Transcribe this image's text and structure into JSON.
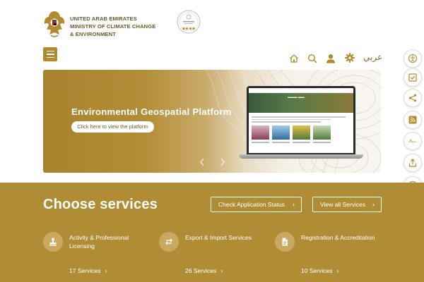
{
  "header": {
    "ministry_lines": [
      "UNITED ARAB EMIRATES",
      "MINISTRY OF CLIMATE CHANGE",
      "& ENVIRONMENT"
    ],
    "icons": [
      "home-icon",
      "search-icon",
      "user-icon",
      "gear-icon"
    ],
    "language_link": "عربي"
  },
  "side_toolbar": {
    "icons": [
      "accessibility-icon",
      "checklist-icon",
      "share-icon",
      "rss-icon",
      "signature-icon",
      "upload-icon",
      "info-icon"
    ]
  },
  "banner": {
    "title": "Environmental Geospatial Platform",
    "cta_label": "Click here to view the platform"
  },
  "services": {
    "title": "Choose services",
    "check_status_label": "Check Application Status",
    "view_all_label": "View all Services",
    "items": [
      {
        "name": "Activity & Professional Licensing",
        "count": "17 Services",
        "icon": "stamp-icon"
      },
      {
        "name": "Export & Import Services",
        "count": "26 Services",
        "icon": "exchange-arrows-icon"
      },
      {
        "name": "Registration & Accreditation",
        "count": "10 Services",
        "icon": "document-icon"
      }
    ]
  },
  "colors": {
    "brand_gold": "#b08d34",
    "menu_gold": "#b28b2e",
    "text_brown": "#6b5a2a"
  }
}
